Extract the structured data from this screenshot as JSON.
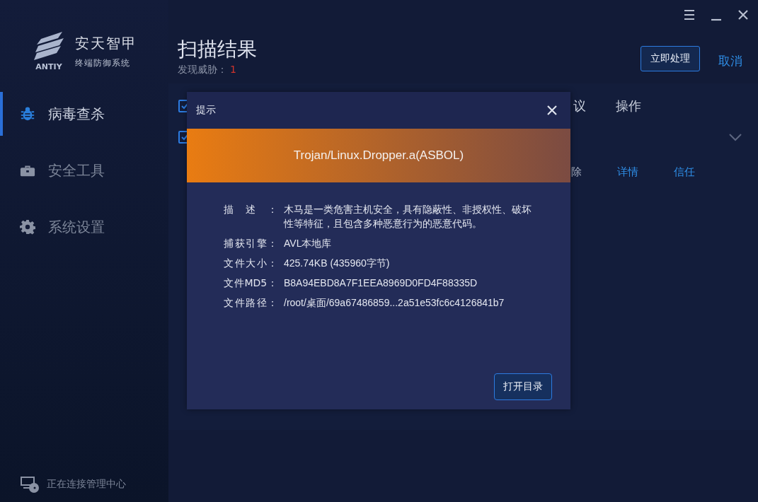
{
  "app": {
    "logo_text": "ANTIY",
    "name": "安天智甲",
    "subtitle": "终端防御系统"
  },
  "sidebar": {
    "items": [
      {
        "label": "病毒查杀",
        "selected": true
      },
      {
        "label": "安全工具",
        "selected": false
      },
      {
        "label": "系统设置",
        "selected": false
      }
    ]
  },
  "status_bar": {
    "text": "正在连接管理中心"
  },
  "page": {
    "title": "扫描结果",
    "summary_label": "发现威胁：",
    "summary_count": "1",
    "actions": [
      {
        "kind": "button",
        "label": "立即处理"
      },
      {
        "kind": "link",
        "label": "取消"
      }
    ]
  },
  "table": {
    "header": {
      "checked": true,
      "columns": [
        "议",
        "操作"
      ]
    },
    "rows": [
      {
        "kind": "group",
        "checked": true
      },
      {
        "kind": "actions",
        "actions": [
          "除",
          "详情",
          "信任"
        ]
      }
    ]
  },
  "dialog": {
    "title": "提示",
    "threat_name": "Trojan/Linux.Dropper.a(ASBOL)",
    "fields": [
      {
        "label": "描述：",
        "value": "木马是一类危害主机安全，具有隐蔽性、非授权性、破坏性等特征，且包含多种恶意行为的恶意代码。"
      },
      {
        "label": "捕获引擎：",
        "value": "AVL本地库"
      },
      {
        "label": "文件大小：",
        "value": "425.74KB (435960字节)"
      },
      {
        "label": "文件MD5：",
        "value": "B8A94EBD8A7F1EEA8969D0FD4F88335D"
      },
      {
        "label": "文件路径：",
        "value": "/root/桌面/69a67486859...2a51e53fc6c4126841b7"
      }
    ],
    "button": "打开目录"
  }
}
